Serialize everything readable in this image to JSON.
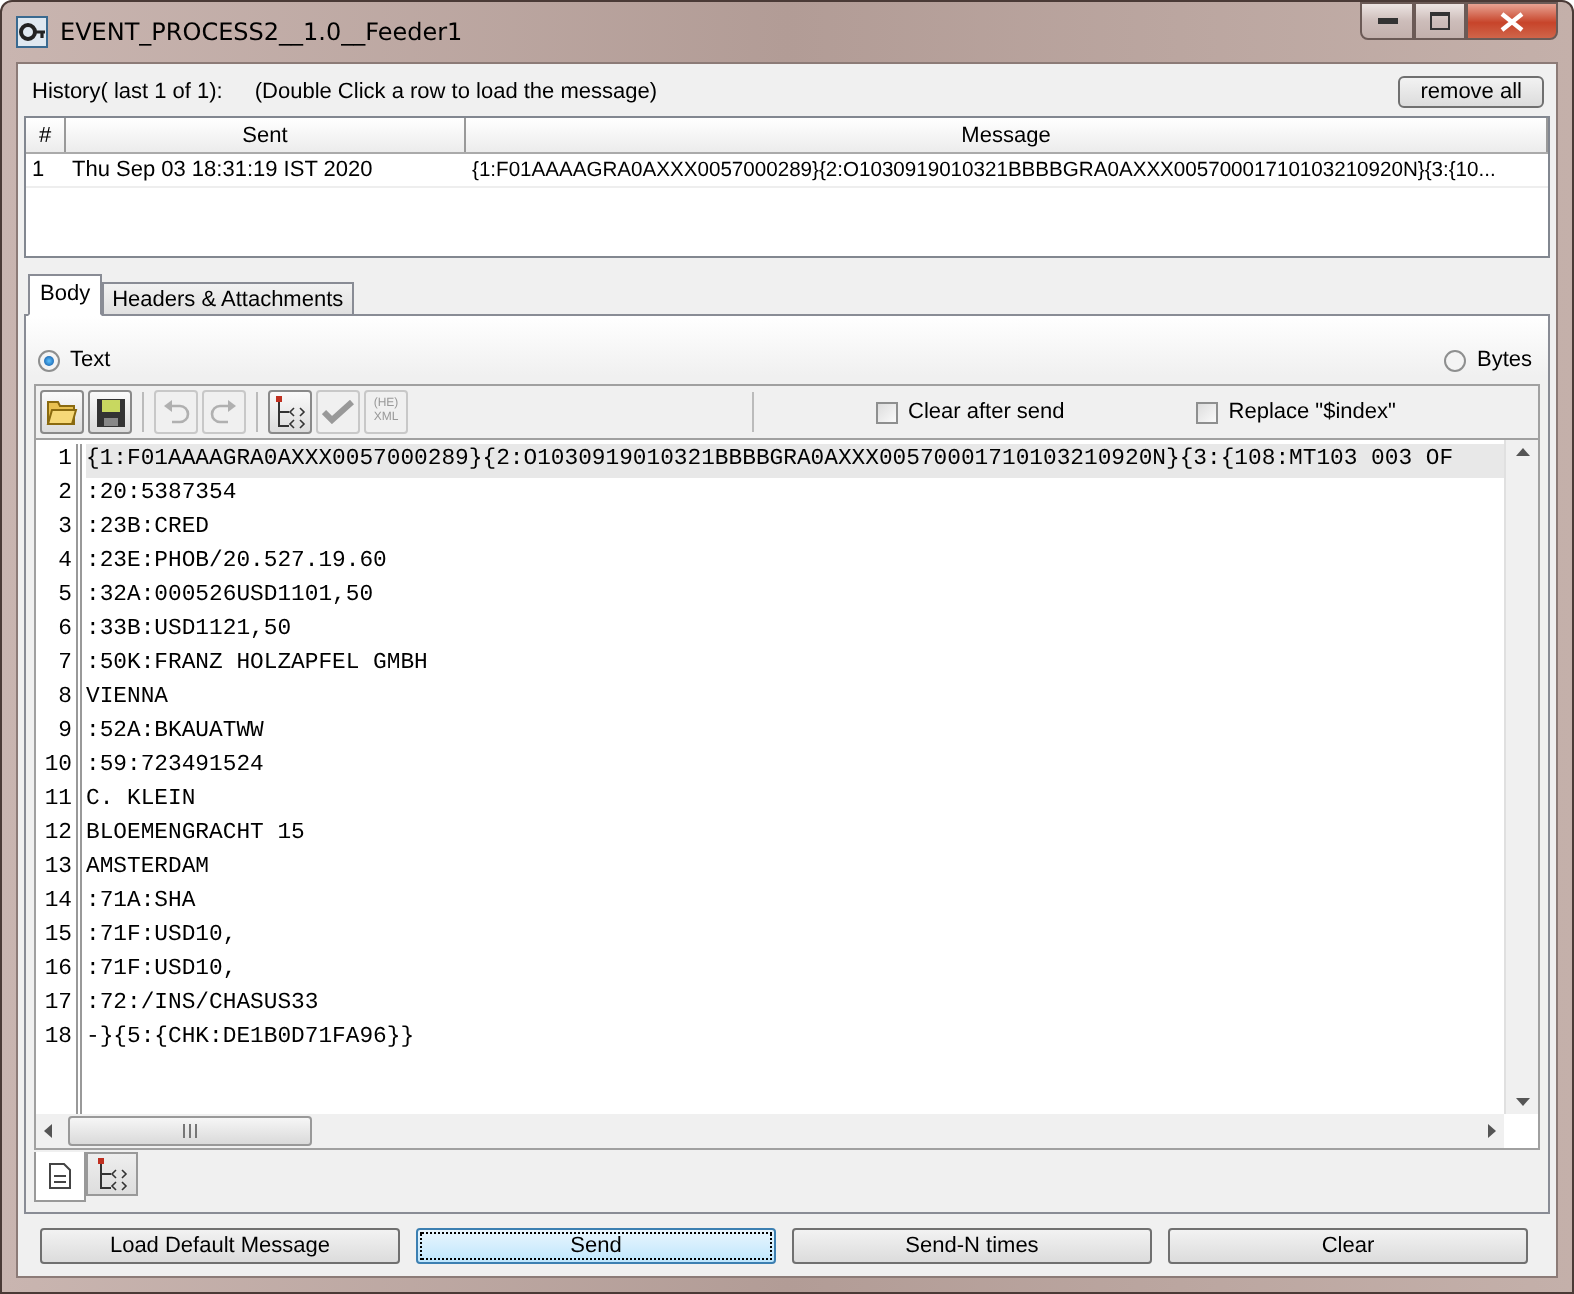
{
  "window": {
    "title": "EVENT_PROCESS2__1.0__Feeder1"
  },
  "history": {
    "label": "History( last 1 of 1):",
    "hint": "(Double Click a row to load the message)",
    "remove_button": "remove all"
  },
  "table": {
    "columns": [
      "#",
      "Sent",
      "Message"
    ],
    "rows": [
      {
        "index": "1",
        "sent": "Thu Sep 03 18:31:19 IST 2020",
        "message": "{1:F01AAAAGRA0AXXX0057000289}{2:O1030919010321BBBBGRA0AXXX00570001710103210920N}{3:{10...",
        "selected": false
      }
    ]
  },
  "tabs": [
    {
      "label": "Body",
      "selected": true
    },
    {
      "label": "Headers & Attachments",
      "selected": false
    }
  ],
  "formats": [
    {
      "label": "Text",
      "selected": true
    },
    {
      "label": "Bytes",
      "selected": false
    }
  ],
  "toolbar": [
    {
      "kind": "open",
      "disabled": false
    },
    {
      "kind": "save",
      "disabled": false
    },
    {
      "kind": "undo",
      "disabled": true
    },
    {
      "kind": "redo",
      "disabled": true
    },
    {
      "kind": "tree",
      "disabled": false
    },
    {
      "kind": "check",
      "disabled": true
    },
    {
      "kind": "hex",
      "disabled": true,
      "label": "(HE) XML"
    }
  ],
  "options": [
    {
      "label": "Clear after send",
      "checked": false
    },
    {
      "label": "Replace \"$index\"",
      "checked": false
    }
  ],
  "editor": {
    "lines": [
      {
        "text": "{1:F01AAAAGRA0AXXX0057000289}{2:O1030919010321BBBBGRA0AXXX00570001710103210920N}{3:{108:MT103 003 OF",
        "current": true
      },
      {
        "text": ":20:5387354",
        "current": false
      },
      {
        "text": ":23B:CRED",
        "current": false
      },
      {
        "text": ":23E:PHOB/20.527.19.60",
        "current": false
      },
      {
        "text": ":32A:000526USD1101,50",
        "current": false
      },
      {
        "text": ":33B:USD1121,50",
        "current": false
      },
      {
        "text": ":50K:FRANZ HOLZAPFEL GMBH",
        "current": false
      },
      {
        "text": "VIENNA",
        "current": false
      },
      {
        "text": ":52A:BKAUATWW",
        "current": false
      },
      {
        "text": ":59:723491524",
        "current": false
      },
      {
        "text": "C. KLEIN",
        "current": false
      },
      {
        "text": "BLOEMENGRACHT 15",
        "current": false
      },
      {
        "text": "AMSTERDAM",
        "current": false
      },
      {
        "text": ":71A:SHA",
        "current": false
      },
      {
        "text": ":71F:USD10,",
        "current": false
      },
      {
        "text": ":71F:USD10,",
        "current": false
      },
      {
        "text": ":72:/INS/CHASUS33",
        "current": false
      },
      {
        "text": "-}{5:{CHK:DE1B0D71FA96}}",
        "current": false
      }
    ],
    "line_numbers": [
      "1",
      "2",
      "3",
      "4",
      "5",
      "6",
      "7",
      "8",
      "9",
      "10",
      "11",
      "12",
      "13",
      "14",
      "15",
      "16",
      "17",
      "18"
    ]
  },
  "view_tabs": [
    {
      "kind": "text",
      "selected": true
    },
    {
      "kind": "tree",
      "selected": false
    }
  ],
  "buttons": [
    {
      "label": "Load Default Message",
      "focused": false
    },
    {
      "label": "Send",
      "focused": true
    },
    {
      "label": "Send-N times",
      "focused": false
    },
    {
      "label": "Clear",
      "focused": false
    }
  ]
}
